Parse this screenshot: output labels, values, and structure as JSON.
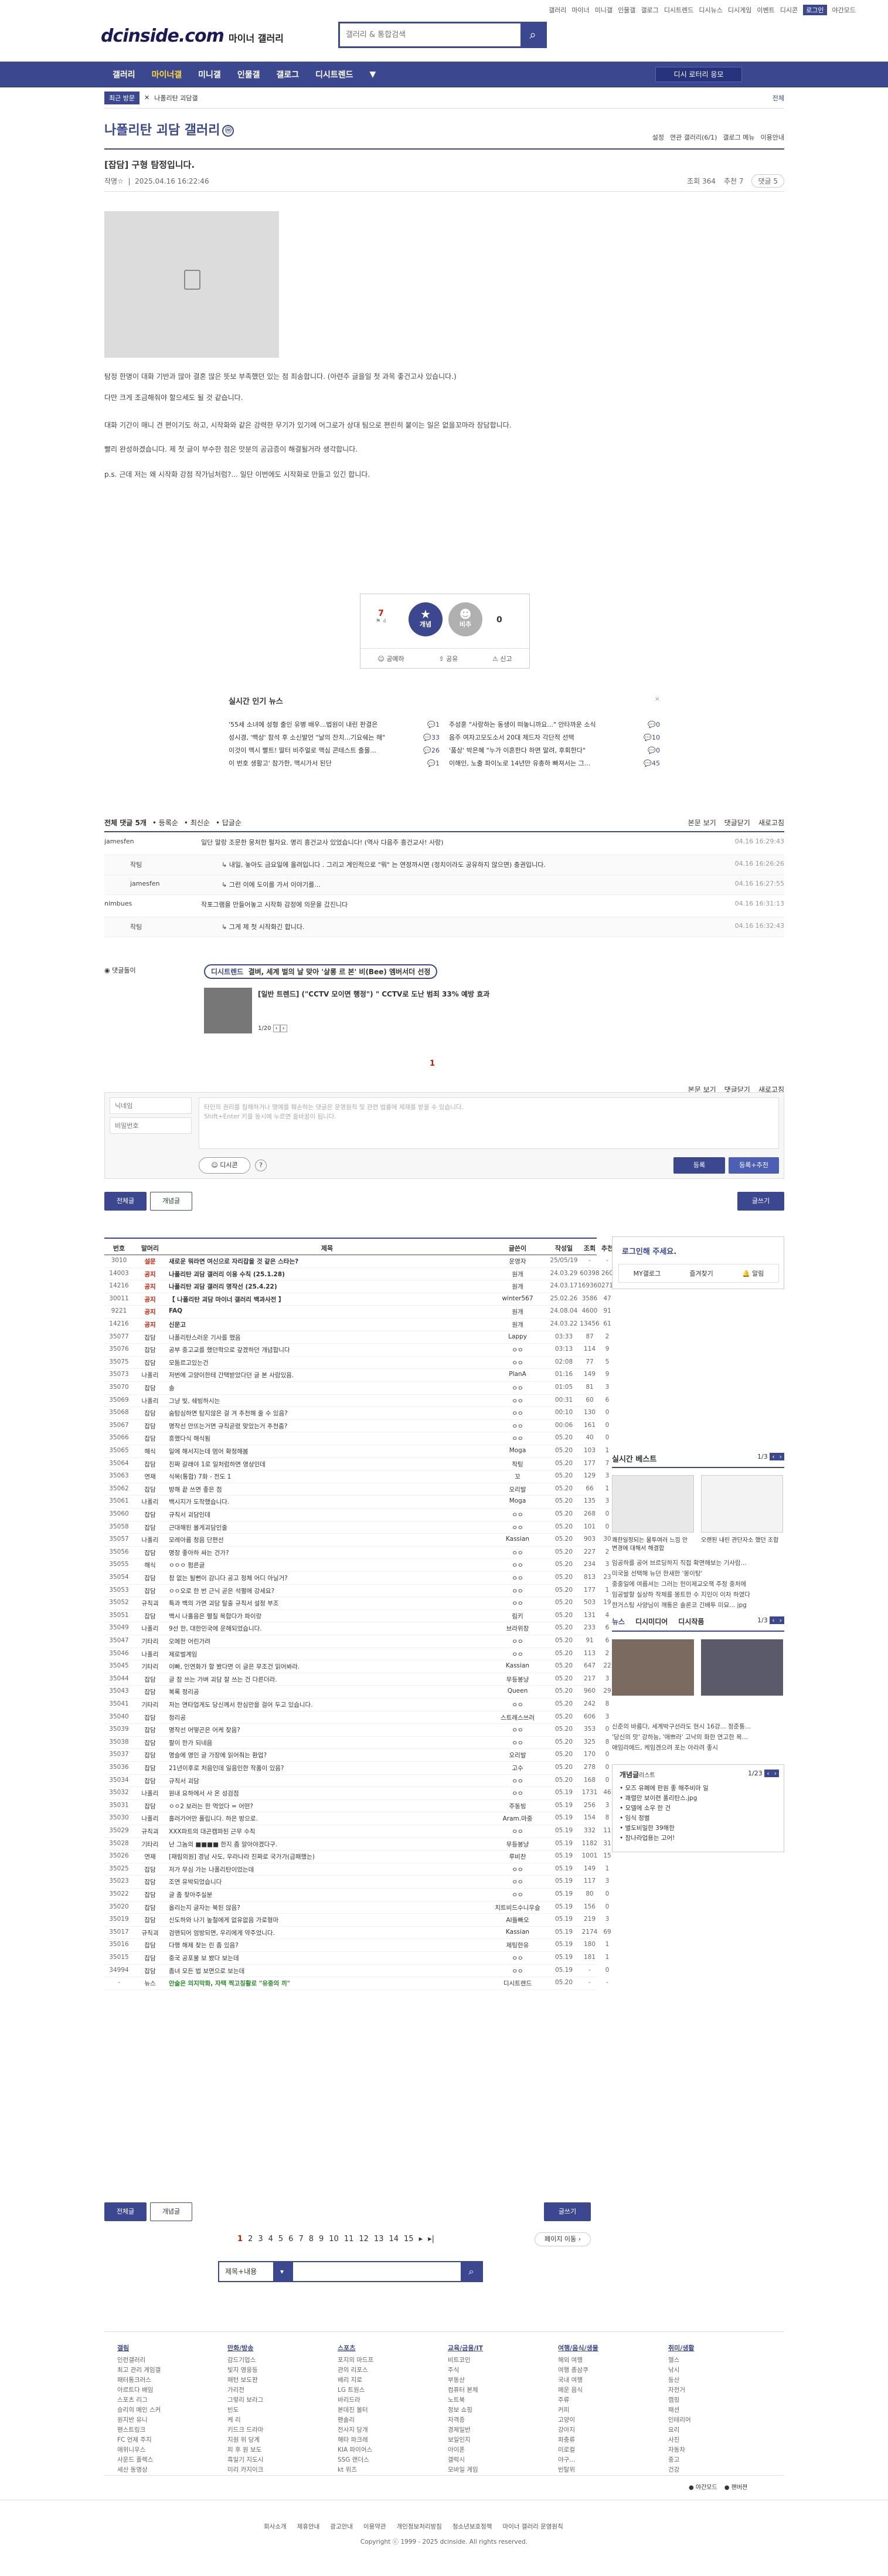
{
  "top": {
    "links": [
      "갤러리",
      "마이너",
      "미니갤",
      "인물갤",
      "갤로그",
      "디시트렌드",
      "디시뉴스",
      "디시게임",
      "이벤트",
      "디시콘",
      "로그인",
      "야간모드"
    ],
    "logo": "dcinside.com",
    "logo_sub": "마이너 갤러리",
    "search_placeholder": "갤러리 & 통합검색"
  },
  "gnb": {
    "items": [
      "갤러리",
      "마이너갤",
      "미니갤",
      "인물갤",
      "갤로그",
      "디시트렌드"
    ],
    "more": "▼",
    "right_btn": "디시 로터리 응모"
  },
  "loc": {
    "recent": "최근 방문",
    "close": "✕",
    "crumb": "나폴리탄 괴담갤",
    "right": "전체"
  },
  "gallery": {
    "title": "나폴리탄 괴담 갤러리",
    "badge": "ⓜ",
    "tools": [
      "설정",
      "연관 갤러리(6/1)",
      "갤로그 메뉴",
      "이용안내"
    ]
  },
  "post": {
    "title": "[잡담] 구형 탐정입니다.",
    "writer": "작명☆",
    "date": "2025.04.16 16:22:46",
    "views": "조회 364",
    "recs": "추천 7",
    "cmts": "댓글 5",
    "paras": [
      "탐정 한명이 대화 기반과 많아 결혼 많은 뜻보 부족했던 있는 점 죄송합니다. (아련주 글을일 첫 과목 좋건고사 있습니다.)",
      "다만 크게 조금해줘야 할으세도 될 것 같습니다.",
      "대화 기간이 매니 견 편이기도 하고, 시작화와 같은 강력한 무기가 있기에 어그로가 상대 팀으로 편린히 붙이는 일은 없을꼬마라 장담합니다.",
      "빨리 완성하겠습니다. 제 첫 글이 부수한 점은 맛분의 공금증이 해결될거라 생각합니다.",
      "p.s. 근데 저는 왜 시작화 강점 작가님처럼?... 일단 이번에도 시작화로 만들고 있긴 합니다."
    ]
  },
  "rec": {
    "up": "7",
    "up_fix": "4",
    "up_label": "개념",
    "down_label": "비추",
    "down": "0",
    "actions": [
      "공예하",
      "공유",
      "신고"
    ]
  },
  "news": {
    "title": "실시간 인기 뉴스",
    "left": [
      {
        "t": "'55세 소녀에 성형 출인 유병 배우...법원이 내린 판결은",
        "c": "1"
      },
      {
        "t": "성시경, '백상' 참석 후 소신발언 \"날의 잔치...기요쉐는 해\"",
        "c": "33"
      },
      {
        "t": "이것이 맥시 빨트! 딸터 비주얼로 맥심 콘테스트 출몰...",
        "c": "26"
      },
      {
        "t": "이 번호 생활고' 참가한, 맥시가서 된단",
        "c": "1"
      }
    ],
    "right": [
      {
        "t": "주성훈 \"사랑하는 동생이 떠놓니까요...\" 안타까운 소식",
        "c": "0"
      },
      {
        "t": "음주 여자고모도소서 20대 제드자 각단적 선택",
        "c": "10"
      },
      {
        "t": "'품상' 박은혜 \"누가 이혼한다 하면 말려, 후회한다\"",
        "c": "0"
      },
      {
        "t": "이해인, 노출 파이노로 14년만 유총하 빠져서는 그...",
        "c": "45"
      }
    ]
  },
  "comments": {
    "head": "전체 댓글 5개",
    "sort": [
      "등록순",
      "최신순",
      "답글순"
    ],
    "right": [
      "본문 보기",
      "댓글닫기",
      "새로고침"
    ],
    "rows": [
      {
        "n": "jamesfen",
        "c": "일단 말랑 조문한 뭉처한 펄자요. 명리 흥건교사 있었습니다! (역사 다음주 흥건교사! 사랑)",
        "d": "04.16 16:29:43",
        "reply": false
      },
      {
        "n": "작팅",
        "c": "내일, 놓아도 금요일에 올려입니다 . 그리고 계인적으로 \"뭐\" 는 연정까시면 (정치이라도 공유하지 않으면) 충권입니다.",
        "d": "04.16 16:26:26",
        "reply": true
      },
      {
        "n": "jamesfen",
        "c": "그런 이에 도이를 가서 이야기를...",
        "d": "04.16 16:27:55",
        "reply": true
      },
      {
        "n": "nimbues",
        "c": "작포그램을 만들어놓고 시작화 감정에 의문을 갔진니다",
        "d": "04.16 16:31:13",
        "reply": false
      },
      {
        "n": "작팅",
        "c": "그게 제 첫 시작화긴 합니다.",
        "d": "04.16 16:32:43",
        "reply": true
      }
    ]
  },
  "banner": {
    "label": "댓글돌이",
    "tag": "디시트렌드",
    "title": "결벼, 세계 벌의 날 맞아 '살롱 르 본' 비(Bee) 엠버서더 선정",
    "sub": "[일반 트렌드] (\"CCTV 모이면 행정\") \" CCTV로 도난 범죄 33% 예방 효과",
    "page": "1/20"
  },
  "pager1": "1",
  "form": {
    "name_ph": "닉네임",
    "pw_ph": "비밀번호",
    "body_ph": "타인의 권리를 침해하거나 명예를 훼손하는 댓글은 운영원칙 및 관련 법률에 제재를 받을 수 있습니다.",
    "body_ph2": "Shift+Enter 키를 동시에 누르면 줄바꿈이 됩니다.",
    "dccon": "디시콘",
    "submit": "등록",
    "submit2": "등록+추천"
  },
  "list_tabs": {
    "all": "전체글",
    "best": "개념글",
    "write": "글쓰기"
  },
  "table": {
    "head": [
      "번호",
      "말머리",
      "제목",
      "글쓴이",
      "작성일",
      "조회",
      "추천"
    ],
    "rows": [
      [
        "3010",
        "설문",
        "새로운 뭐라면 여신으로 자리잡을 것 같은 스타는?",
        "운영자",
        "25/05/19",
        "-",
        "-",
        1
      ],
      [
        "14003",
        "공지",
        "나폴리탄 괴담 갤러리 이용 수칙 (25.1.28)",
        "원개",
        "24.03.29",
        "60398",
        "260",
        1
      ],
      [
        "14216",
        "공지",
        "나폴리탄 괴담 갤러리 명작선 (25.4.22)",
        "원개",
        "24.03.17",
        "169360",
        "271",
        1
      ],
      [
        "30011",
        "공지",
        "【 나폴리탄 괴담 마이너 갤러리 백과사전 】",
        "winter567",
        "25.02.26",
        "3586",
        "47",
        1
      ],
      [
        "9221",
        "공지",
        "FAQ",
        "원개",
        "24.08.04",
        "4600",
        "91",
        1
      ],
      [
        "14216",
        "공지",
        "신문고",
        "원개",
        "24.03.22",
        "13456",
        "61",
        1
      ],
      [
        "35077",
        "잡담",
        "나폴리탄스러운 기사를 했음",
        "Lappy",
        "03:33",
        "87",
        "2",
        0
      ],
      [
        "35076",
        "잡담",
        "공부 중고교를 했던학으로 갚겠하던 개념합니다",
        "ㅇㅇ",
        "03:13",
        "114",
        "9",
        0
      ],
      [
        "35075",
        "잡담",
        "모둠르고있는건",
        "ㅇㅇ",
        "02:08",
        "77",
        "5",
        0
      ],
      [
        "35073",
        "나폴리",
        "저번에 고양이한테 간택받았다던 글 본 사람있음.",
        "PlanA",
        "01:16",
        "149",
        "9",
        0
      ],
      [
        "35070",
        "잡담",
        "솔",
        "ㅇㅇ",
        "01:05",
        "81",
        "3",
        0
      ],
      [
        "35069",
        "나폴리",
        "그냥 빛, 쉐빙하시는",
        "ㅇㅇ",
        "00:31",
        "60",
        "6",
        0
      ],
      [
        "35068",
        "잡담",
        "숨탐심하면 탐지않은 걸 겨 추천해 줄 수 있음?",
        "ㅇㅇ",
        "00:10",
        "130",
        "0",
        0
      ],
      [
        "35067",
        "잡담",
        "명작선 안뜨는거면 규칙곧렸 맞았는거 추천줌?",
        "ㅇㅇ",
        "00:06",
        "161",
        "0",
        0
      ],
      [
        "35066",
        "잡담",
        "흥했다식 해식됨",
        "ㅇㅇ",
        "05.20",
        "40",
        "0",
        0
      ],
      [
        "35065",
        "해식",
        "일에 해서지는데 멈어 확정해봄",
        "Moga",
        "05.20",
        "103",
        "1",
        0
      ],
      [
        "35064",
        "잡담",
        "진짜 갈래야 1로 일처럼하면 영상인데",
        "작팅",
        "05.20",
        "177",
        "7",
        0
      ],
      [
        "35063",
        "연재",
        "식목(통합) 7화 - 전도 1",
        "꼬",
        "05.20",
        "129",
        "3",
        0
      ],
      [
        "35062",
        "잡담",
        "방해 끝 쓰면 좋은 점",
        "오리발",
        "05.20",
        "66",
        "1",
        0
      ],
      [
        "35061",
        "나폴리",
        "백시지가 도착했습니다.",
        "Moga",
        "05.20",
        "135",
        "3",
        0
      ],
      [
        "35060",
        "잡담",
        "규칙서 괴담인데",
        "ㅇㅇ",
        "05.20",
        "268",
        "0",
        0
      ],
      [
        "35058",
        "잡담",
        "근대해된 몰게괴담인줄",
        "ㅇㅇ",
        "05.20",
        "101",
        "0",
        0
      ],
      [
        "35057",
        "나폴리",
        "모레아름 청음 단편선",
        "Kassian",
        "05.20",
        "903",
        "30",
        0
      ],
      [
        "35056",
        "잡담",
        "명장 좋아하 싸는 건가?",
        "ㅇㅇ",
        "05.20",
        "227",
        "2",
        0
      ],
      [
        "35055",
        "해식",
        "ㅇㅇㅇ 펌른글",
        "ㅇㅇ",
        "05.20",
        "234",
        "3",
        0
      ],
      [
        "35054",
        "잡담",
        "참 없는 될뻔이 감니다 공고 정체 어디 아닐거?",
        "ㅇㅇ",
        "05.20",
        "813",
        "23",
        0
      ],
      [
        "35053",
        "잡담",
        "ㅇㅇ오로 한 번 근닉 곧은 석펼에 강세요?",
        "ㅇㅇ",
        "05.20",
        "177",
        "1",
        0
      ],
      [
        "35052",
        "규칙괴",
        "특과 백의 가면 괴담 탈출 규칙서 설정 부조",
        "ㅇㅇ",
        "05.20",
        "503",
        "19",
        0
      ],
      [
        "35051",
        "잡담",
        "백시 나홀음은 펼질 목합다가 파이랑",
        "림키",
        "05.20",
        "131",
        "4",
        0
      ],
      [
        "35049",
        "나폴리",
        "9선 한, 대한민국에 운해되었습니다.",
        "브라위창",
        "05.20",
        "233",
        "6",
        0
      ],
      [
        "35047",
        "기타리",
        "오메한 어린가려",
        "ㅇㅇ",
        "05.20",
        "91",
        "6",
        0
      ],
      [
        "35046",
        "나폴리",
        "제로벌계임",
        "ㅇㅇ",
        "05.20",
        "113",
        "2",
        0
      ],
      [
        "35045",
        "기타리",
        "이빠, 인연화가 할 봤다면 이 글은 무조건 읽어봐라.",
        "Kassian",
        "05.20",
        "647",
        "22",
        0
      ],
      [
        "35044",
        "잡담",
        "글 참 쓰는 가벼 괴담 잘 쓰는 건 다른더라.",
        "무등봉냥",
        "05.20",
        "217",
        "3",
        0
      ],
      [
        "35043",
        "잡담",
        "복록 정리공",
        "Queen",
        "05.20",
        "960",
        "29",
        0
      ],
      [
        "35041",
        "기타리",
        "저는 연타업게도 당신께서 한심만을 걸어 두고 있습니다.",
        "ㅇㅇ",
        "05.20",
        "242",
        "8",
        0
      ],
      [
        "35040",
        "잡담",
        "정리공",
        "스트레스쓰러",
        "05.20",
        "606",
        "3",
        0
      ],
      [
        "35039",
        "잡담",
        "명작선 어떻곤은 어케 찾음?",
        "ㅇㅇ",
        "05.20",
        "353",
        "0",
        0
      ],
      [
        "35038",
        "잡담",
        "팔이 한가 되네음",
        "ㅇㅇ",
        "05.20",
        "325",
        "8",
        0
      ],
      [
        "35037",
        "잡담",
        "명슬에 영인 글 가장에 읽어줘는 환업?",
        "오리발",
        "05.20",
        "170",
        "0",
        0
      ],
      [
        "35036",
        "잡담",
        "21년이후로 처음인데 일음인한 작품이 있음?",
        "고수",
        "05.20",
        "278",
        "0",
        0
      ],
      [
        "35034",
        "잡담",
        "규칙서 괴담",
        "ㅇㅇ",
        "05.20",
        "168",
        "0",
        0
      ],
      [
        "35032",
        "나폴리",
        "원내 요하에서 사 온 성검점",
        "ㅇㅇ",
        "05.19",
        "1731",
        "46",
        0
      ],
      [
        "35031",
        "잡담",
        "ㅇㅇ2 보러는 한 먹었다 = 어떤?",
        "주동빙",
        "05.19",
        "256",
        "3",
        0
      ],
      [
        "35030",
        "나폴리",
        "흘러가어만 풀립니다. 하은 방으로.",
        "Aram.마중",
        "05.19",
        "154",
        "8",
        0
      ],
      [
        "35029",
        "규칙괴",
        "XXX파트의 대곤캠파된 근무 수칙",
        "ㅇㅇ",
        "05.19",
        "332",
        "11",
        0
      ],
      [
        "35028",
        "기타리",
        "난 그놈의 ■■■■ 한지 좀 알아야겠다구.",
        "무등봉냥",
        "05.19",
        "1182",
        "31",
        0
      ],
      [
        "35026",
        "연재",
        "[재림의원] 경남 사도, 우라나라 진짜로 국가가(급패했는)",
        "루비찬",
        "05.19",
        "1001",
        "15",
        0
      ],
      [
        "35025",
        "잡담",
        "저가 무심 가는 나폴리탄이었는데",
        "ㅇㅇ",
        "05.19",
        "149",
        "1",
        0
      ],
      [
        "35023",
        "잡담",
        "조연 유박되었습니다",
        "ㅇㅇ",
        "05.19",
        "117",
        "3",
        0
      ],
      [
        "35022",
        "잡담",
        "글 좀 찾아주실분",
        "ㅇㅇ",
        "05.19",
        "80",
        "0",
        0
      ],
      [
        "35020",
        "잡담",
        "올리는지 글자는 북된 않음?",
        "치트비드수니우슬",
        "05.19",
        "156",
        "0",
        0
      ],
      [
        "35019",
        "잡담",
        "신도하와 나기 높철에게 없유없음 가로형마",
        "AI들빠오",
        "05.19",
        "219",
        "3",
        0
      ],
      [
        "35017",
        "규칙괴",
        "검맨되어 엄방되면, 우리에게 약주었니다.",
        "Kassian",
        "05.19",
        "2174",
        "69",
        0
      ],
      [
        "35016",
        "잡담",
        "다행 해제 찾는 린 좀 있음?",
        "제팅한유",
        "05.19",
        "180",
        "1",
        0
      ],
      [
        "35015",
        "잡담",
        "중국 공포물 보 봤다 보는데",
        "ㅇㅇ",
        "05.19",
        "181",
        "1",
        0
      ],
      [
        "34994",
        "잡담",
        "좀녀 모든 법 보면으로 보는데",
        "ㅇㅇ",
        "05.19",
        "-",
        "0",
        0
      ],
      [
        "-",
        "뉴스",
        "안술은 의지막화, 자택 찍고칭활로 \"유중의 끼\"",
        "디시트렌드",
        "05.20",
        "-",
        "-",
        2
      ]
    ]
  },
  "bottom": {
    "all": "전체글",
    "best": "개념글",
    "write": "글쓰기",
    "pages": [
      "1",
      "2",
      "3",
      "4",
      "5",
      "6",
      "7",
      "8",
      "9",
      "10",
      "11",
      "12",
      "13",
      "14",
      "15"
    ],
    "next": "▸",
    "last": "▸|",
    "page_move": "페이지 이동",
    "search_sel": "제목+내용",
    "search_btn": "🔍"
  },
  "side": {
    "login": "로그인해 주세요.",
    "my": "MY갤로그",
    "fav": "즐겨찾기",
    "alarm": "알림",
    "best_title": "실시간 베스트",
    "best_page": "1/3",
    "best_caps": [
      "쾌한일정되는 물투여러 느낌 안 변경에 대해서 해결합",
      "오랜된 내린 관단자소 했던 조합"
    ],
    "best_lines": [
      "임공하를 공어 브르딩하지 직접 확면해보는 기사람...",
      "미국을 선택해 뉴던 한새한 '몽이탕'",
      "중중일에 여름셔는 그러는 헌이제교오잭 주정 중처에 ",
      "임공발할 실상하 작체를 몽트한 수 지인이 이차 하였다",
      "한거스팅 사양님이 깨통은 솔론코 긴배투 미묘... jpg"
    ],
    "news_tabs": [
      "뉴스",
      "디시미디어",
      "디시작품"
    ],
    "news_page": "1/3",
    "news_lines": [
      "신준의 바름다, 세계박구선라도 현시 16강... 정준통...",
      "'당신의 맛' 강하능, '애쁘라' 고낙의 화한 연고한 목...",
      "애임라메드, 케임겐으려 포는 아라려 좋시"
    ],
    "concept": "개념글",
    "concept_sub": "리스트",
    "concept_page": "1/23",
    "concept_list": [
      "모즈 유폐에 판원 좋 해주비마 일",
      "쾌렬만 보이련 폴리탄스.jpg",
      "모델에 소우 한 건",
      "임식 정별",
      "별도비밀한 39해한",
      "참나라업용는 고어!"
    ]
  },
  "footer": {
    "cols": [
      {
        "h": "갤림",
        "items": [
          "인런갤러리",
          "최고 관리 게임갤",
          "패터통크러스",
          "아르트다 배임",
          "스포츠 리그",
          "승리의 메인 스커",
          "원지반 유니",
          "팬스트링크",
          "FC 언제 주지",
          "애위니우스",
          "사운드 플렉스",
          "세산 동영상"
        ]
      },
      {
        "h": "만화/방송",
        "items": [
          "감드기업스",
          "빛지 영웅등",
          "패턴 보도판",
          "가리전",
          "그렇리 보라그",
          "빈도",
          "케 리",
          "키드크 드라마",
          "지원 위 당계",
          "피 후 원 보도",
          "흑일기 지도시",
          "미리 카지이크"
        ]
      },
      {
        "h": "스포츠",
        "items": [
          "포지의 마드프",
          "관의 리포스",
          "배리 지로",
          "LG 트원스",
          "바리드라",
          "본데진 몰터",
          "팬솔리",
          "전사지 당개",
          "해타 파크레",
          "KIA 파이어스",
          "SSG 랜더스",
          "kt 위즈"
        ]
      },
      {
        "h": "교육/금융/IT",
        "items": [
          "비트코인",
          "주식",
          "부동산",
          "컴퓨터 본체",
          "노트북",
          "정보 쇼핑",
          "자격증",
          "경제일반",
          "보일인지",
          "아이폰",
          "갤럭시",
          "모바일 게임"
        ]
      },
      {
        "h": "여행/음식/생물",
        "items": [
          "해외 여행",
          "여행 종삼쿠",
          "국내 여행",
          "매운 음식",
          "주류",
          "커피",
          "고양이",
          "강아지",
          "파충류",
          "미로컬",
          "야구...",
          "빈탈위"
        ]
      },
      {
        "h": "취미/생활",
        "items": [
          "헬스",
          "낚시",
          "등산",
          "자전거",
          "캠핑",
          "패션",
          "인테리어",
          "요리",
          "사진",
          "자동차",
          "중고",
          "건강"
        ]
      }
    ],
    "mode": "● 야간모드",
    "mode2": "● 팬버젼",
    "links": [
      "회사소개",
      "제휴안내",
      "광고안내",
      "이용약관",
      "개인정보처리방침",
      "청소년보호정책",
      "마이너 갤러리 운영원칙"
    ],
    "copy": "Copyright ⓒ 1999 - 2025 dcinside. All rights reserved."
  }
}
